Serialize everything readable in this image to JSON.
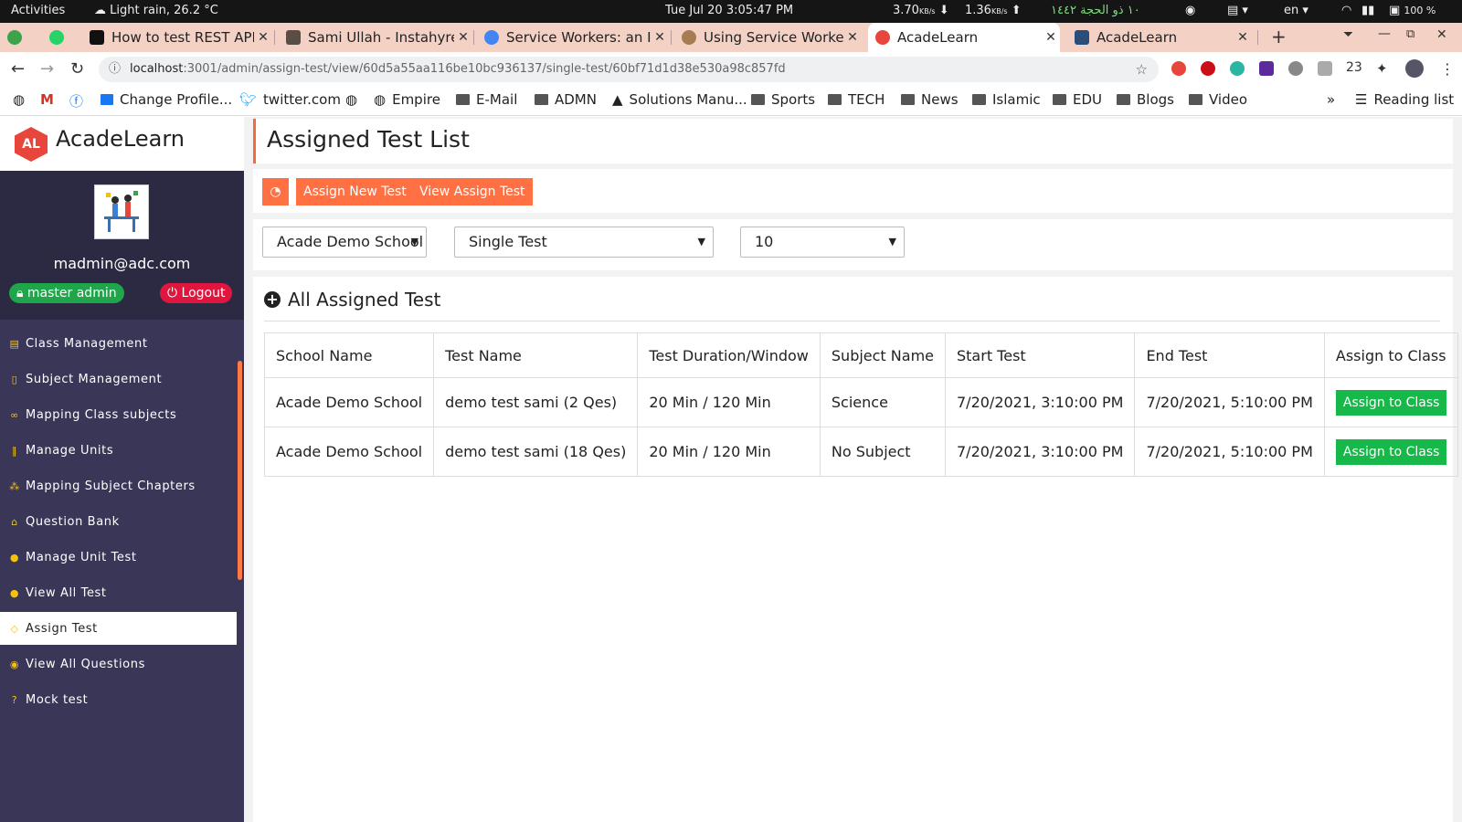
{
  "os": {
    "activities": "Activities",
    "weather": "Light rain, 26.2 °C",
    "clock": "Tue Jul 20   3:05:47 PM",
    "net_down": "3.70",
    "net_down_unit": "KB/s",
    "net_up": "1.36",
    "net_up_unit": "KB/s",
    "hijri_date": "١٠ ذو الحجة ١٤٤٢",
    "lang": "en",
    "battery": "100 %"
  },
  "browser": {
    "tabs": [
      {
        "title": "How to test REST API v"
      },
      {
        "title": "Sami Ullah - Instahyre"
      },
      {
        "title": "Service Workers: an In"
      },
      {
        "title": "Using Service Workers"
      },
      {
        "title": "AcadeLearn"
      },
      {
        "title": "AcadeLearn"
      }
    ],
    "url_host": "localhost",
    "url_path": ":3001/admin/assign-test/view/60d5a55aa116be10bc936137/single-test/60bf71d1d38e530a98c857fd",
    "ext_badge": "23",
    "bookmarks": [
      "Change Profile...",
      "twitter.com",
      "Empire",
      "E-Mail",
      "ADMN",
      "Solutions Manu...",
      "Sports",
      "TECH",
      "News",
      "Islamic",
      "EDU",
      "Blogs",
      "Video"
    ],
    "reading_list": "Reading list"
  },
  "app": {
    "logo_text": "AL",
    "brand": "AcadeLearn",
    "user_email": "madmin@adc.com",
    "role": "master admin",
    "logout": "Logout",
    "menu": [
      {
        "label": "Class Management",
        "icon": "list-icon"
      },
      {
        "label": "Subject Management",
        "icon": "book-icon"
      },
      {
        "label": "Mapping Class subjects",
        "icon": "link-icon"
      },
      {
        "label": "Manage Units",
        "icon": "bars-icon"
      },
      {
        "label": "Mapping Subject Chapters",
        "icon": "sitemap-icon"
      },
      {
        "label": "Question Bank",
        "icon": "bank-icon"
      },
      {
        "label": "Manage Unit Test",
        "icon": "face-icon"
      },
      {
        "label": "View All Test",
        "icon": "face-icon"
      },
      {
        "label": "Assign Test",
        "icon": "diamond-icon"
      },
      {
        "label": "View All Questions",
        "icon": "eye-icon"
      },
      {
        "label": "Mock test",
        "icon": "question-icon"
      }
    ],
    "active_menu": "Assign Test"
  },
  "page": {
    "title": "Assigned Test List",
    "assign_new": "Assign New Test",
    "view_assign": "View Assign Test",
    "filter_school": "Acade Demo School",
    "filter_type": "Single Test",
    "filter_count": "10",
    "panel_title": "All Assigned Test",
    "columns": [
      "School Name",
      "Test Name",
      "Test Duration/Window",
      "Subject Name",
      "Start Test",
      "End Test",
      "Assign to Class"
    ],
    "rows": [
      {
        "school": "Acade Demo School",
        "test": "demo test sami (2 Qes)",
        "duration": "20 Min / 120 Min",
        "subject": "Science",
        "start": "7/20/2021, 3:10:00 PM",
        "end": "7/20/2021, 5:10:00 PM",
        "action": "Assign to Class"
      },
      {
        "school": "Acade Demo School",
        "test": "demo test sami (18 Qes)",
        "duration": "20 Min / 120 Min",
        "subject": "No Subject",
        "start": "7/20/2021, 3:10:00 PM",
        "end": "7/20/2021, 5:10:00 PM",
        "action": "Assign to Class"
      }
    ]
  }
}
